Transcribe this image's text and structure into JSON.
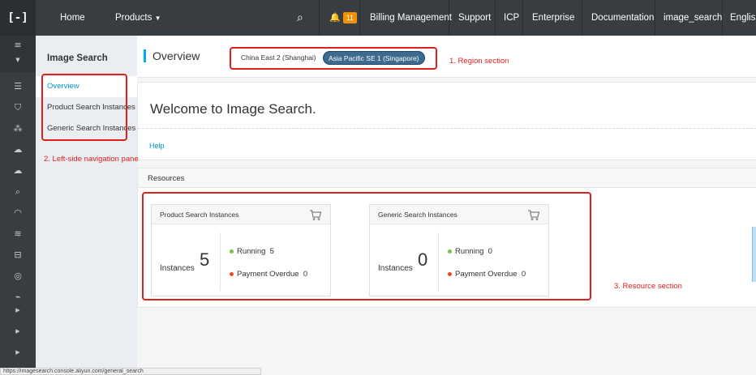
{
  "topbar": {
    "logo": "[-]",
    "home": "Home",
    "products": "Products",
    "notifications_count": "11",
    "billing": "Billing Management",
    "support": "Support",
    "icp": "ICP",
    "enterprise": "Enterprise",
    "documentation": "Documentation",
    "account": "image_search",
    "language": "English"
  },
  "sidebar": {
    "title": "Image Search",
    "items": [
      {
        "label": "Overview",
        "active": true
      },
      {
        "label": "Product Search Instances",
        "active": false
      },
      {
        "label": "Generic Search Instances",
        "active": false
      }
    ]
  },
  "header": {
    "title": "Overview",
    "regions": [
      {
        "label": "China East 2 (Shanghai)",
        "active": false
      },
      {
        "label": "Asia Pacific SE 1 (Singapore)",
        "active": true
      }
    ]
  },
  "welcome": {
    "text": "Welcome to Image Search.",
    "help": "Help"
  },
  "resources": {
    "title": "Resources",
    "cards": [
      {
        "title": "Product Search Instances",
        "instances_label": "Instances",
        "count": "5",
        "running_label": "Running",
        "running": "5",
        "overdue_label": "Payment Overdue",
        "overdue": "0"
      },
      {
        "title": "Generic Search Instances",
        "instances_label": "Instances",
        "count": "0",
        "running_label": "Running",
        "running": "0",
        "overdue_label": "Payment Overdue",
        "overdue": "0"
      }
    ]
  },
  "annotations": {
    "region": "1. Region section",
    "nav": "2. Left-side navigation pane",
    "resource": "3. Resource section"
  },
  "status_bar": {
    "url": "https://imagesearch.console.aliyun.com/general_search"
  },
  "colors": {
    "topbar": "#373d41",
    "accent": "#00aaee",
    "link": "#0099cc",
    "running": "#7ac143",
    "overdue": "#e84a24",
    "annotation": "#e02020"
  }
}
